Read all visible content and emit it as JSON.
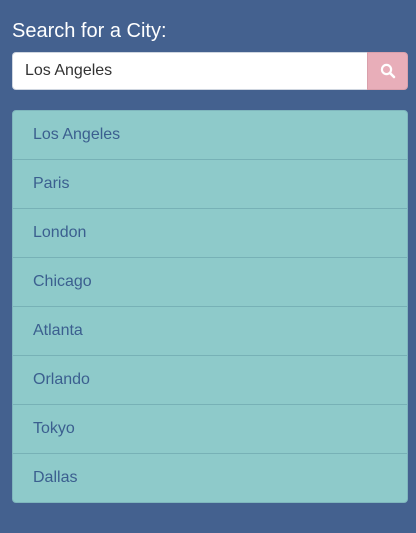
{
  "heading": "Search for a City:",
  "search": {
    "value": "Los Angeles",
    "button_icon": "search-icon"
  },
  "cities": [
    "Los Angeles",
    "Paris",
    "London",
    "Chicago",
    "Atlanta",
    "Orlando",
    "Tokyo",
    "Dallas"
  ],
  "colors": {
    "background": "#44618f",
    "search_button": "#e8aeb9",
    "list_background": "#8ecaca",
    "list_text": "#3b5f8f"
  }
}
